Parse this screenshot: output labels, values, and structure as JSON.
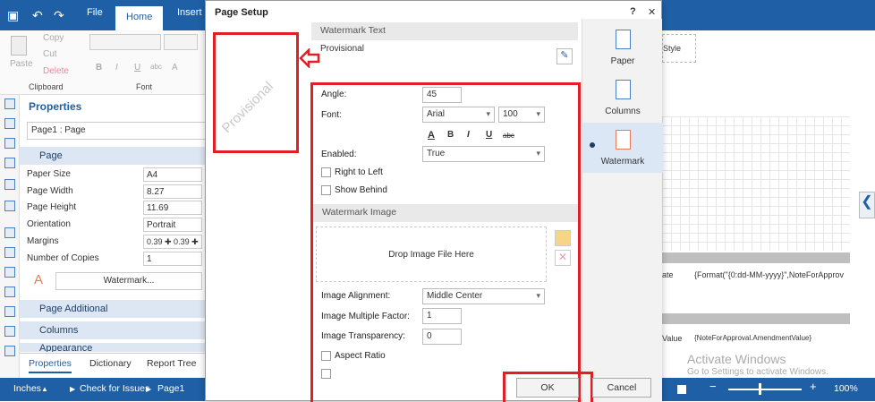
{
  "ribbon": {
    "tabs": [
      "File",
      "Home",
      "Insert"
    ],
    "active_tab": "Home",
    "clipboard": {
      "copy": "Copy",
      "cut": "Cut",
      "delete": "Delete",
      "paste": "Paste",
      "caption": "Clipboard"
    },
    "font_caption": "Font",
    "font_buttons": [
      "B",
      "I",
      "U",
      "abc",
      "A"
    ]
  },
  "properties": {
    "title": "Properties",
    "selection": "Page1 : Page",
    "page_section": "Page",
    "rows": [
      {
        "label": "Paper Size",
        "value": "A4"
      },
      {
        "label": "Page Width",
        "value": "8.27"
      },
      {
        "label": "Page Height",
        "value": "11.69"
      },
      {
        "label": "Orientation",
        "value": "Portrait"
      },
      {
        "label": "Margins",
        "value": "0.39 ✚ 0.39 ✚"
      },
      {
        "label": "Number of Copies",
        "value": "1"
      }
    ],
    "watermark_button": "Watermark...",
    "sections": [
      "Page Additional",
      "Columns",
      "Appearance"
    ],
    "bottom_tabs": [
      "Properties",
      "Dictionary",
      "Report Tree"
    ]
  },
  "status": {
    "units": "Inches",
    "check": "Check for Issues",
    "page": "Page1",
    "zoom": "100%"
  },
  "canvas": {
    "style_label": "Style",
    "format_text": "{Format(\"{0:dd-MM-yyyy}\",NoteForApprov",
    "date_label": "ate",
    "value_label": "Value",
    "amendment_text": "{NoteForApproval.AmendmentValue}",
    "activate_title": "Activate Windows",
    "activate_sub": "Go to Settings to activate Windows."
  },
  "dialog": {
    "title": "Page Setup",
    "help": "?",
    "close": "✕",
    "preview_text": "Provisional",
    "watermark_text_header": "Watermark Text",
    "watermark_text_value": "Provisional",
    "angle_label": "Angle:",
    "angle_value": "45",
    "font_label": "Font:",
    "font_name": "Arial",
    "font_size": "100",
    "font_style_buttons": [
      "A",
      "B",
      "I",
      "U",
      "abc"
    ],
    "enabled_label": "Enabled:",
    "enabled_value": "True",
    "right_to_left": "Right to Left",
    "show_behind": "Show Behind",
    "watermark_image_header": "Watermark Image",
    "drop_zone": "Drop Image File Here",
    "image_alignment_label": "Image Alignment:",
    "image_alignment_value": "Middle Center",
    "multiple_factor_label": "Image Multiple Factor:",
    "multiple_factor_value": "1",
    "transparency_label": "Image Transparency:",
    "transparency_value": "0",
    "aspect_ratio": "Aspect Ratio",
    "ok": "OK",
    "cancel": "Cancel",
    "side_items": [
      "Paper",
      "Columns",
      "Watermark"
    ],
    "active_side": "Watermark",
    "highlight_color": "#e01f26"
  }
}
